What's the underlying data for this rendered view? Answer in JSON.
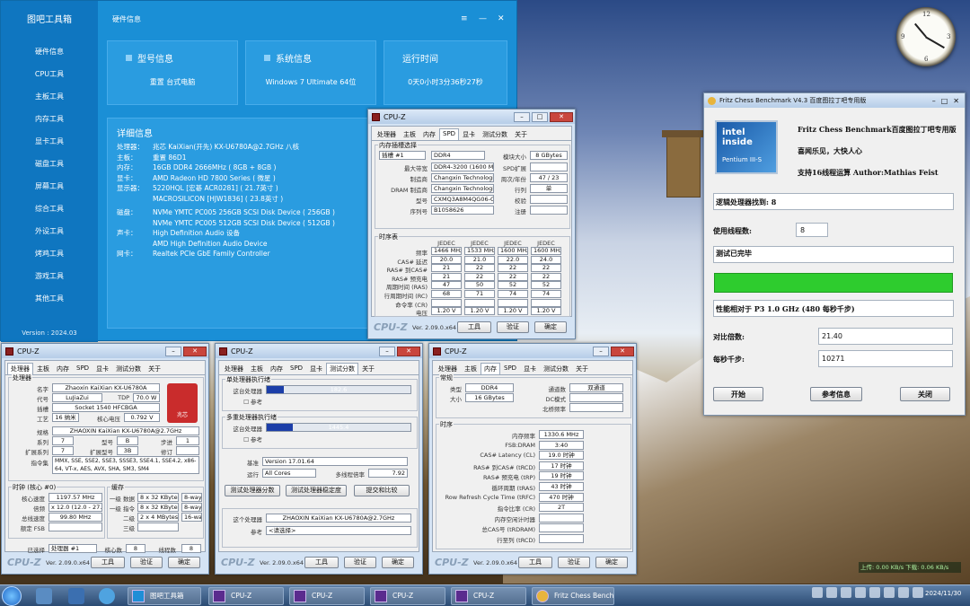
{
  "toolbox": {
    "logo": "图吧工具箱",
    "title": "硬件信息",
    "controls": [
      "≡",
      "—",
      "✕"
    ],
    "version": "Version : 2024.03",
    "nav": [
      "硬件信息",
      "CPU工具",
      "主板工具",
      "内存工具",
      "显卡工具",
      "磁盘工具",
      "屏幕工具",
      "综合工具",
      "外设工具",
      "烤鸡工具",
      "游戏工具",
      "其他工具"
    ],
    "cards": [
      {
        "title": "型号信息",
        "value": "重置  台式电脑"
      },
      {
        "title": "系统信息",
        "value": "Windows 7 Ultimate 64位"
      },
      {
        "title": "运行时间",
        "value": "0天0小时3分36秒27秒"
      }
    ],
    "detail_title": "详细信息",
    "details": [
      [
        "处理器：",
        "兆芯 KaiXian(开先) KX-U6780A@2.7GHz 八核"
      ],
      [
        "主板：",
        "重置 86D1"
      ],
      [
        "内存：",
        "16GB DDR4 2666MHz ( 8GB + 8GB )"
      ],
      [
        "显卡：",
        "AMD Radeon HD 7800 Series ( 微星 )"
      ],
      [
        "显示器：",
        "5220HQL [宏碁 ACR0281] ( 21.7英寸 )"
      ],
      [
        "",
        "MACROSILICON [HJW1836] ( 23.8英寸 )"
      ],
      [
        "磁盘：",
        "NVMe YMTC PC005 256GB SCSI Disk Device ( 256GB )"
      ],
      [
        "",
        "NVMe YMTC PC005 512GB SCSI Disk Device ( 512GB )"
      ],
      [
        "声卡：",
        "High Definition Audio 设备"
      ],
      [
        "",
        "AMD High Definition Audio Device"
      ],
      [
        "网卡：",
        "Realtek PCIe GbE Family Controller"
      ]
    ]
  },
  "cpuz_spd": {
    "title": "CPU-Z",
    "tabs": [
      "处理器",
      "主板",
      "内存",
      "SPD",
      "显卡",
      "测试分数",
      "关于"
    ],
    "active": "SPD",
    "slot_group": "内存插槽选择",
    "slot": "插槽 #1",
    "type": "DDR4",
    "module_size_label": "模块大小",
    "module_size": "8 GBytes",
    "rows": [
      [
        "最大带宽",
        "DDR4-3200 (1600 MHz)",
        "SPD扩展",
        ""
      ],
      [
        "制造商",
        "Changxin Technologies",
        "周次/年份",
        "47 / 23"
      ],
      [
        "DRAM 制造商",
        "Changxin Technologies",
        "行列",
        "单"
      ],
      [
        "型号",
        "CXMQ3A8M4QG06-CJ1-A",
        "校验",
        ""
      ],
      [
        "序列号",
        "B1058626",
        "注册",
        ""
      ]
    ],
    "timing_group": "时序表",
    "jedec_headers": [
      "JEDEC #11",
      "JEDEC #12",
      "JEDEC #13",
      "JEDEC #14"
    ],
    "timing": [
      [
        "频率",
        "1466 MHz",
        "1533 MHz",
        "1600 MHz",
        "1600 MHz"
      ],
      [
        "CAS# 延迟",
        "20.0",
        "21.0",
        "22.0",
        "24.0"
      ],
      [
        "RAS# 到CAS#",
        "21",
        "22",
        "22",
        "22"
      ],
      [
        "RAS# 预充电",
        "21",
        "22",
        "22",
        "22"
      ],
      [
        "周期时间 (RAS)",
        "47",
        "50",
        "52",
        "52"
      ],
      [
        "行周期时间 (RC)",
        "68",
        "71",
        "74",
        "74"
      ],
      [
        "命令率 (CR)",
        "",
        "",
        "",
        ""
      ],
      [
        "电压",
        "1.20 V",
        "1.20 V",
        "1.20 V",
        "1.20 V"
      ]
    ],
    "version": "Ver. 2.09.0.x64",
    "tool_btn": "工具",
    "verify_btn": "验证",
    "ok_btn": "确定"
  },
  "cpuz_cpu": {
    "title": "CPU-Z",
    "tabs": [
      "处理器",
      "主板",
      "内存",
      "SPD",
      "显卡",
      "测试分数",
      "关于"
    ],
    "active": "处理器",
    "group": "处理器",
    "name_label": "名字",
    "name": "Zhaoxin KaiXian KX-U6780A",
    "code_label": "代号",
    "code": "LuJiaZui",
    "tdp_label": "TDP",
    "tdp": "70.0 W",
    "socket_label": "插槽",
    "socket": "Socket 1540 HFCBGA",
    "tech_label": "工艺",
    "tech": "16 纳米",
    "vcore_label": "核心电压",
    "vcore": "0.792 V",
    "spec_label": "规格",
    "spec": "ZHAOXIN KaiXian KX-U6780A@2.7GHz",
    "family_label": "系列",
    "family": "7",
    "model_label": "型号",
    "model": "B",
    "stepping_label": "步进",
    "stepping": "1",
    "extfam_label": "扩展系列",
    "extfam": "7",
    "extmod_label": "扩展型号",
    "extmod": "3B",
    "rev_label": "修订",
    "rev": "",
    "instr_label": "指令集",
    "instr": "MMX, SSE, SSE2, SSE3, SSSE3, SSE4.1, SSE4.2, x86-64, VT-x, AES, AVX, SHA, SM3, SM4",
    "clock_group": "时钟 (核心 #0)",
    "cache_group": "缓存",
    "core_speed_label": "核心速度",
    "core_speed": "1197.57 MHz",
    "mult_label": "倍频",
    "mult": "x 12.0 (12.0 - 27.0)",
    "bus_label": "总线速度",
    "bus": "99.80 MHz",
    "fsb_label": "额定 FSB",
    "fsb": "",
    "l1d_label": "一级 数据",
    "l1d": "8 x 32 KBytes",
    "l1d_way": "8-way",
    "l1i_label": "一级 指令",
    "l1i": "8 x 32 KBytes",
    "l1i_way": "8-way",
    "l2_label": "二级",
    "l2": "2 x 4 MBytes",
    "l2_way": "16-way",
    "l3_label": "三级",
    "l3": "",
    "sel_label": "已选择",
    "sel": "处理器 #1",
    "cores_label": "核心数",
    "cores": "8",
    "threads_label": "线程数",
    "threads": "8",
    "version": "Ver. 2.09.0.x64",
    "tool_btn": "工具",
    "verify_btn": "验证",
    "ok_btn": "确定",
    "badge_text": "兆芯"
  },
  "cpuz_bench": {
    "title": "CPU-Z",
    "tabs": [
      "处理器",
      "主板",
      "内存",
      "SPD",
      "显卡",
      "测试分数",
      "关于"
    ],
    "active": "测试分数",
    "single_group": "单处理器执行绪",
    "single_label": "这台处理器",
    "single_value": "182.6",
    "single_frac": 0.12,
    "ref_label": "参考",
    "multi_group": "多重处理器执行绪",
    "multi_label": "这台处理器",
    "multi_value": "1445.4",
    "multi_frac": 0.18,
    "bench_label": "基准",
    "bench": "Version 17.01.64",
    "threads_label": "运行",
    "threads": "All Cores",
    "ratio_label": "多线程倍率",
    "ratio": "7.92",
    "b1": "测试处理器分数",
    "b2": "测试处理器稳定度",
    "b3": "提交和比较",
    "this_label": "这个处理器",
    "this": "ZHAOXIN KaiXian KX-U6780A@2.7GHz",
    "ref_sel_label": "参考",
    "ref_sel": "<请选择>",
    "version": "Ver. 2.09.0.x64",
    "tool_btn": "工具",
    "verify_btn": "验证",
    "ok_btn": "确定"
  },
  "cpuz_mem": {
    "title": "CPU-Z",
    "tabs": [
      "处理器",
      "主板",
      "内存",
      "SPD",
      "显卡",
      "测试分数",
      "关于"
    ],
    "active": "内存",
    "general_group": "常规",
    "type_label": "类型",
    "type": "DDR4",
    "channel_label": "通道数",
    "channel": "双通道",
    "size_label": "大小",
    "size": "16 GBytes",
    "dc_label": "DC模式",
    "dc": "",
    "nb_label": "北桥频率",
    "nb": "",
    "timing_group": "时序",
    "timing": [
      [
        "内存频率",
        "1330.6 MHz"
      ],
      [
        "FSB:DRAM",
        "3:40"
      ],
      [
        "CAS# Latency (CL)",
        "19.0 时钟"
      ],
      [
        "RAS# 到CAS# (tRCD)",
        "17 时钟"
      ],
      [
        "RAS# 预充电 (tRP)",
        "19 时钟"
      ],
      [
        "循环周期 (tRAS)",
        "43 时钟"
      ],
      [
        "Row Refresh Cycle Time (tRFC)",
        "470 时钟"
      ],
      [
        "指令比率 (CR)",
        "2T"
      ],
      [
        "内存空闲计时器",
        ""
      ],
      [
        "总CAS号 (tRDRAM)",
        ""
      ],
      [
        "行至列 (tRCD)",
        ""
      ]
    ],
    "version": "Ver. 2.09.0.x64",
    "tool_btn": "工具",
    "verify_btn": "验证",
    "ok_btn": "确定"
  },
  "fritz": {
    "title": "Fritz Chess Benchmark V4.3  百度图拉丁吧专用版",
    "line1": "Fritz Chess Benchmark百度图拉丁吧专用版",
    "line2": "喜闻乐见，大快人心",
    "line3": "支持16线程运算  Author:Mathias Feist",
    "logical_label": "逻辑处理器找到: 8",
    "threads_label": "使用线程数:",
    "threads": "8",
    "status": "测试已完毕",
    "progress_frac": 1.0,
    "perf_label": "性能相对于 P3 1.0 GHz (480 每秒千步)",
    "ratio_label": "对比倍数:",
    "ratio": "21.40",
    "kn_label": "每秒千步:",
    "kn": "10271",
    "start_btn": "开始",
    "ref_btn": "参考信息",
    "close_btn": "关闭",
    "intel_inside": "intel inside",
    "pentium": "Pentium III-S"
  },
  "taskbar": {
    "items": [
      "图吧工具箱",
      "CPU-Z",
      "CPU-Z",
      "CPU-Z",
      "CPU-Z",
      "Fritz Chess Bench..."
    ],
    "net_up": "上传: 0.00 KB/s",
    "net_down": "下载: 0.06 KB/s",
    "date": "2024/11/30"
  },
  "clock_numbers": [
    "12",
    "3",
    "6",
    "9"
  ]
}
